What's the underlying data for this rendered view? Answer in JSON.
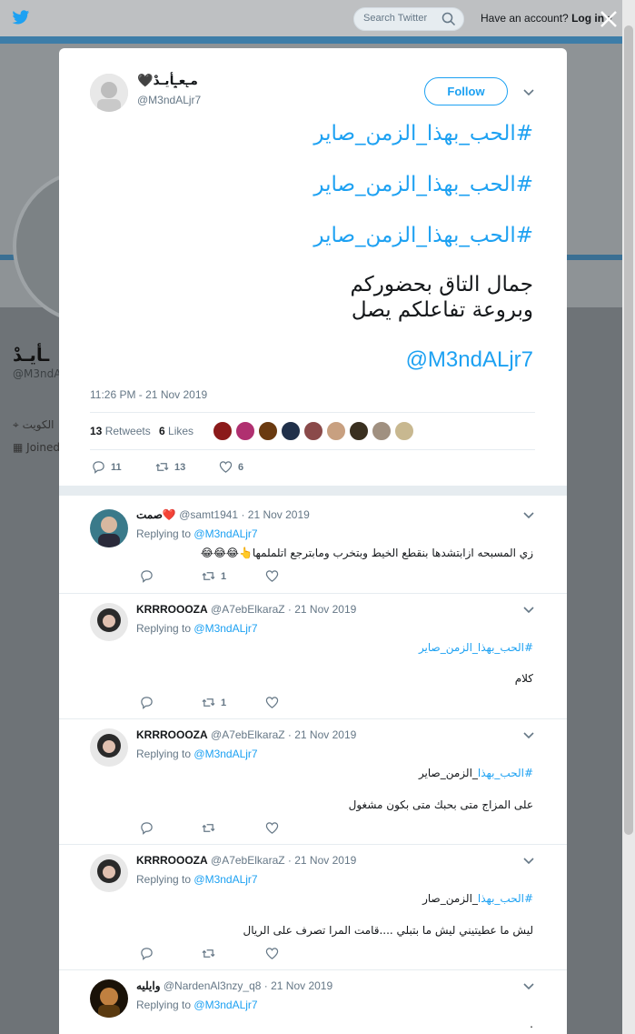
{
  "topbar": {
    "search_placeholder": "Search Twitter",
    "account_prompt": "Have an account?",
    "login_label": "Log in"
  },
  "background_profile": {
    "name": "ـأيـدْ",
    "handle": "@M3ndAL",
    "location": "الكويت",
    "joined": "Joined"
  },
  "tweet": {
    "author_name": "🖤ﻣ̨ـﻌ̝ـأيـدْ",
    "author_handle": "@M3ndALjr7",
    "follow_label": "Follow",
    "hashtag_lines": [
      "#الحب_بهذا_الزمن_صاير",
      "#الحب_بهذا_الزمن_صاير",
      "#الحب_بهذا_الزمن_صاير"
    ],
    "text_lines": [
      "جمال التاق بحضوركم",
      "وبروعة تفاعلكم يصل"
    ],
    "mention": "@M3ndALjr7",
    "timestamp": "11:26 PM - 21 Nov 2019",
    "retweets_count": "13",
    "retweets_label": "Retweets",
    "likes_count": "6",
    "likes_label": "Likes",
    "liker_colors": [
      "#8b1a1a",
      "#b03070",
      "#6a3a10",
      "#20304a",
      "#8a4a4a",
      "#c8a080",
      "#3a3020",
      "#a09080",
      "#c8b890"
    ],
    "reply_count": "11",
    "retweet_count_action": "13",
    "like_count_action": "6"
  },
  "replies": [
    {
      "name": "صمت❤️",
      "handle": "@samt1941",
      "date": "21 Nov 2019",
      "replying_prefix": "Replying to",
      "replying_to": "@M3ndALjr7",
      "lines": [
        "زي المسبحه ازابتشدها بنقطع الخيط وبتخرب ومابترجع اتلملمها👆",
        "😂😂😂"
      ],
      "retweets": "1",
      "avatar_color": "#3a7a8a"
    },
    {
      "name": "KRRROOOZA",
      "handle": "@A7ebElkaraZ",
      "date": "21 Nov 2019",
      "replying_prefix": "Replying to",
      "replying_to": "@M3ndALjr7",
      "hashtag": "#الحب_بهذا_الزمن_صاير",
      "text": "كلام",
      "retweets": "1",
      "avatar_color": "#2a2a2a"
    },
    {
      "name": "KRRROOOZA",
      "handle": "@A7ebElkaraZ",
      "date": "21 Nov 2019",
      "replying_prefix": "Replying to",
      "replying_to": "@M3ndALjr7",
      "hashtag": "#الحب_بهذا",
      "hashtag_rest": "_الزمن_صاير",
      "text": "على المزاج متى بحبك متى بكون مشغول",
      "avatar_color": "#2a2a2a"
    },
    {
      "name": "KRRROOOZA",
      "handle": "@A7ebElkaraZ",
      "date": "21 Nov 2019",
      "replying_prefix": "Replying to",
      "replying_to": "@M3ndALjr7",
      "hashtag": "#الحب_بهذا",
      "hashtag_rest": "_الزمن_صار",
      "text": "ليش ما عطيتيني ليش ما بتبلي ....قامت المرا تصرف على الريال",
      "avatar_color": "#2a2a2a"
    },
    {
      "name": "وايليه",
      "handle": "@NardenAl3nzy_q8",
      "date": "21 Nov 2019",
      "replying_prefix": "Replying to",
      "replying_to": "@M3ndALjr7",
      "text": ".",
      "avatar_color": "#5a3a10"
    }
  ]
}
